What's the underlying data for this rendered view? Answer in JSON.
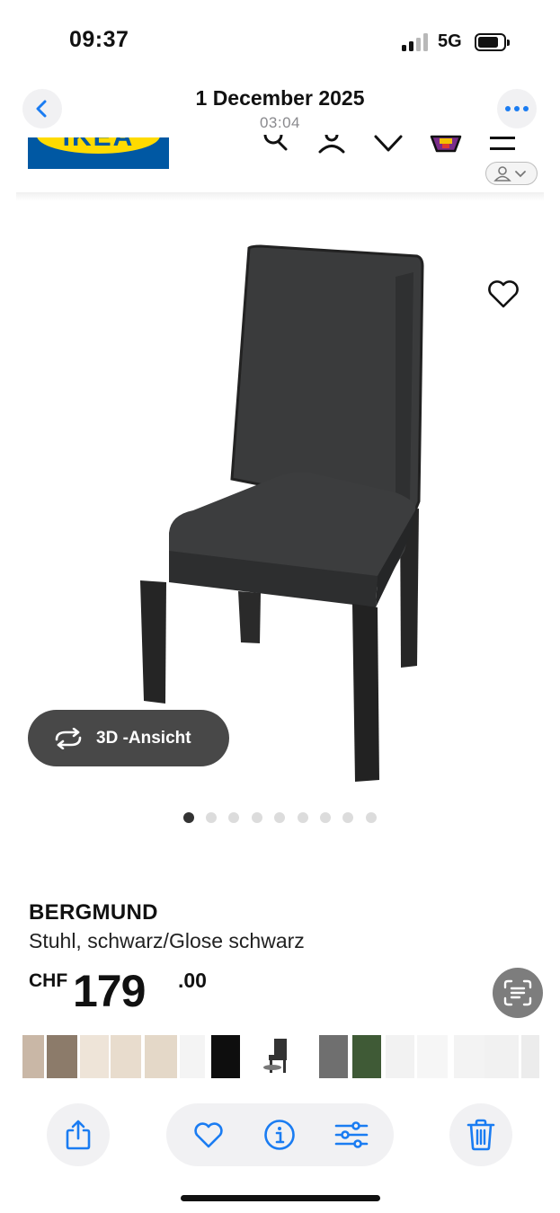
{
  "status_bar": {
    "time": "09:37",
    "network": "5G"
  },
  "photo_header": {
    "date": "1 December 2025",
    "time": "03:04"
  },
  "site_header": {
    "logo_text": "IKEA"
  },
  "product": {
    "name": "BERGMUND",
    "description": "Stuhl, schwarz/Glose schwarz",
    "price_currency": "CHF",
    "price_integer": "179",
    "price_decimal": ".00",
    "view_3d_label": "3D -Ansicht",
    "image_count": 9,
    "active_image": 1
  },
  "toolbar": {
    "icons": [
      "share-icon",
      "heart-icon",
      "info-icon",
      "adjust-icon",
      "trash-icon"
    ]
  },
  "colors": {
    "accent_blue": "#1a7cf2",
    "ikea_blue": "#0058a3",
    "ikea_yellow": "#ffdb00"
  }
}
